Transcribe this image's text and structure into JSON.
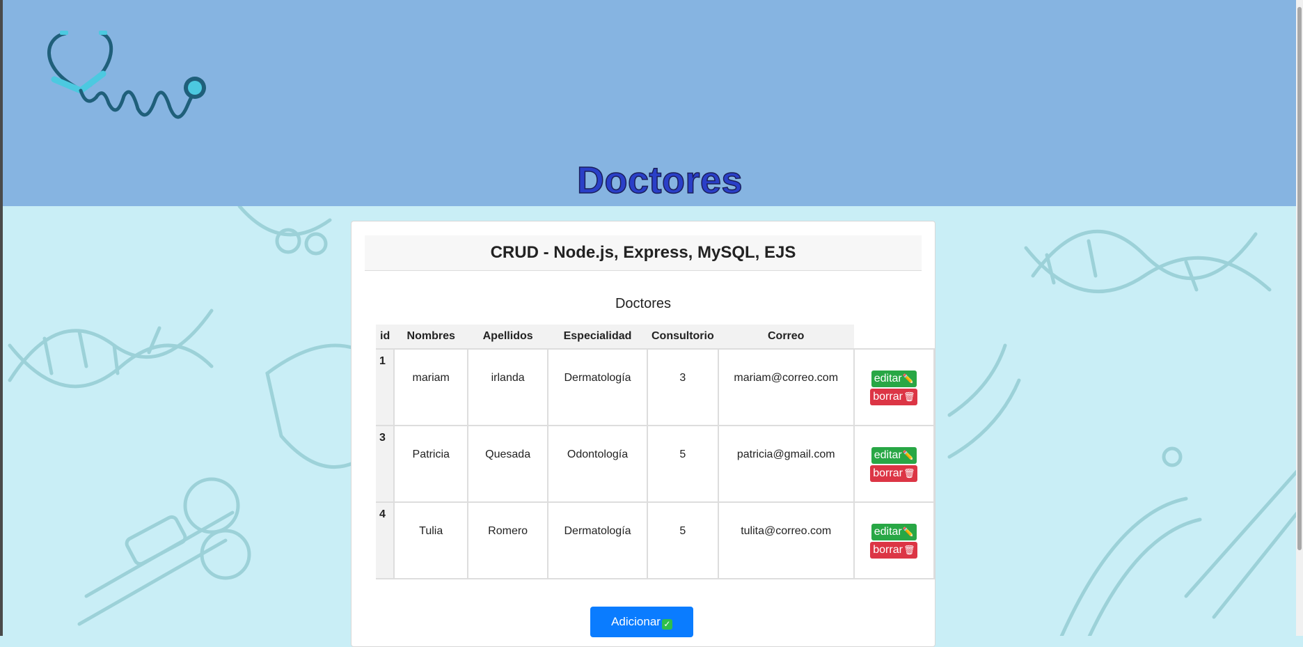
{
  "header": {
    "logo_icon": "stethoscope-icon",
    "title": "Doctores",
    "background_color": "#86b4e1",
    "title_color": "#2a3fc8"
  },
  "card": {
    "header_title": "CRUD - Node.js, Express, MySQL, EJS",
    "table_caption": "Doctores"
  },
  "table": {
    "columns": [
      "id",
      "Nombres",
      "Apellidos",
      "Especialidad",
      "Consultorio",
      "Correo"
    ],
    "rows": [
      {
        "id": "1",
        "nombres": "mariam",
        "apellidos": "irlanda",
        "especialidad": "Dermatología",
        "consultorio": "3",
        "correo": "mariam@correo.com"
      },
      {
        "id": "3",
        "nombres": "Patricia",
        "apellidos": "Quesada",
        "especialidad": "Odontología",
        "consultorio": "5",
        "correo": "patricia@gmail.com"
      },
      {
        "id": "4",
        "nombres": "Tulia",
        "apellidos": "Romero",
        "especialidad": "Dermatología",
        "consultorio": "5",
        "correo": "tulita@correo.com"
      }
    ]
  },
  "actions": {
    "edit_label": "editar",
    "edit_icon": "pencil-icon",
    "delete_label": "borrar",
    "delete_icon": "trash-icon",
    "add_label": "Adicionar",
    "add_icon": "check-icon",
    "edit_color": "#28a745",
    "delete_color": "#dc3545",
    "add_color": "#0a7cff"
  }
}
